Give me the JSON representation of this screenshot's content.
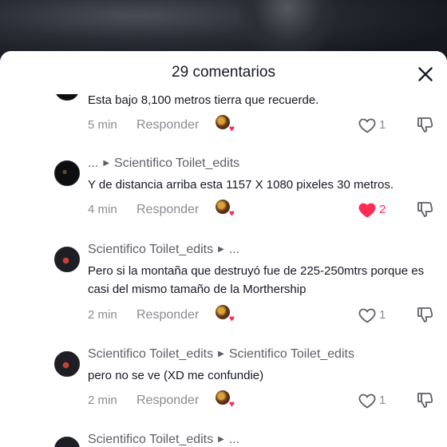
{
  "header": {
    "title": "29 comentarios"
  },
  "colors": {
    "accent": "#fe2c55",
    "text": "#161823",
    "muted": "#8a8b91"
  },
  "comments": [
    {
      "text": "Esta bajo 8,100 metros tierra que recuerde.",
      "time": "5 min",
      "reply": "Responder",
      "likes": "1",
      "liked": false
    },
    {
      "user": "...",
      "replying_to": "Scientifico Toilet_edits",
      "text": "Y de distancia arriba esta 1157 X 1080 pixeles 30 metros.",
      "time": "4 min",
      "reply": "Responder",
      "likes": "2",
      "liked": true
    },
    {
      "user": "Scientifico Toilet_edits",
      "replying_to": "...",
      "text": "Pero si la montaña que destruyó fue de 225-250mtrs porque es casi del mismo tamaño de la Morthership",
      "time": "2 min",
      "reply": "Responder",
      "likes": "1",
      "liked": false
    },
    {
      "user": "Scientifico Toilet_edits",
      "replying_to": "Scientifico Toilet_edits",
      "text": "pero no se ve (XD me confundie)",
      "time": "2 min",
      "reply": "Responder",
      "likes": "1",
      "liked": false
    },
    {
      "user": "Scientifico Toilet_edits",
      "replying_to": "..."
    }
  ]
}
